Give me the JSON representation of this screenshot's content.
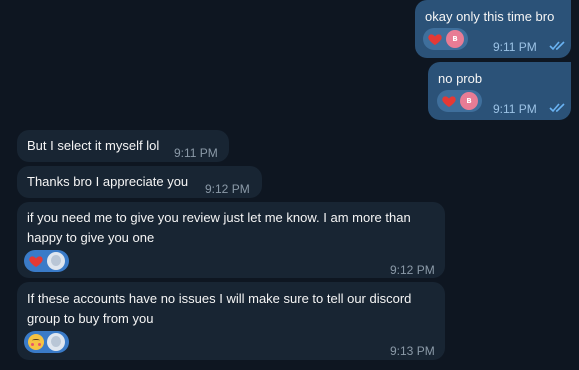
{
  "messages": [
    {
      "direction": "out",
      "text": "okay only this time bro",
      "time": "9:11 PM",
      "reactions": [
        "heart-icon",
        "avatar-b"
      ]
    },
    {
      "direction": "out",
      "text": "no prob",
      "time": "9:11 PM",
      "reactions": [
        "heart-icon",
        "avatar-b"
      ]
    },
    {
      "direction": "in",
      "text": "But I select it myself lol",
      "time": "9:11 PM"
    },
    {
      "direction": "in",
      "text": "Thanks bro I appreciate you",
      "time": "9:12 PM"
    },
    {
      "direction": "in",
      "text_lines": [
        "if you need me to give you review just let me know. I am more than",
        "happy to give you one"
      ],
      "time": "9:12 PM",
      "reactions": [
        "heart-icon",
        "avatar-white"
      ]
    },
    {
      "direction": "in",
      "text_lines": [
        "If these accounts have no issues I will make sure to tell our discord",
        "group to buy from you"
      ],
      "time": "9:13 PM",
      "reactions": [
        "kissing-face-icon",
        "avatar-white"
      ]
    }
  ],
  "avatar_initial": "B",
  "colors": {
    "background": "#0e1621",
    "outgoing_bubble": "#2b5278",
    "incoming_bubble": "#182533",
    "heart": "#e53935",
    "read_check": "#6ab3f3"
  }
}
